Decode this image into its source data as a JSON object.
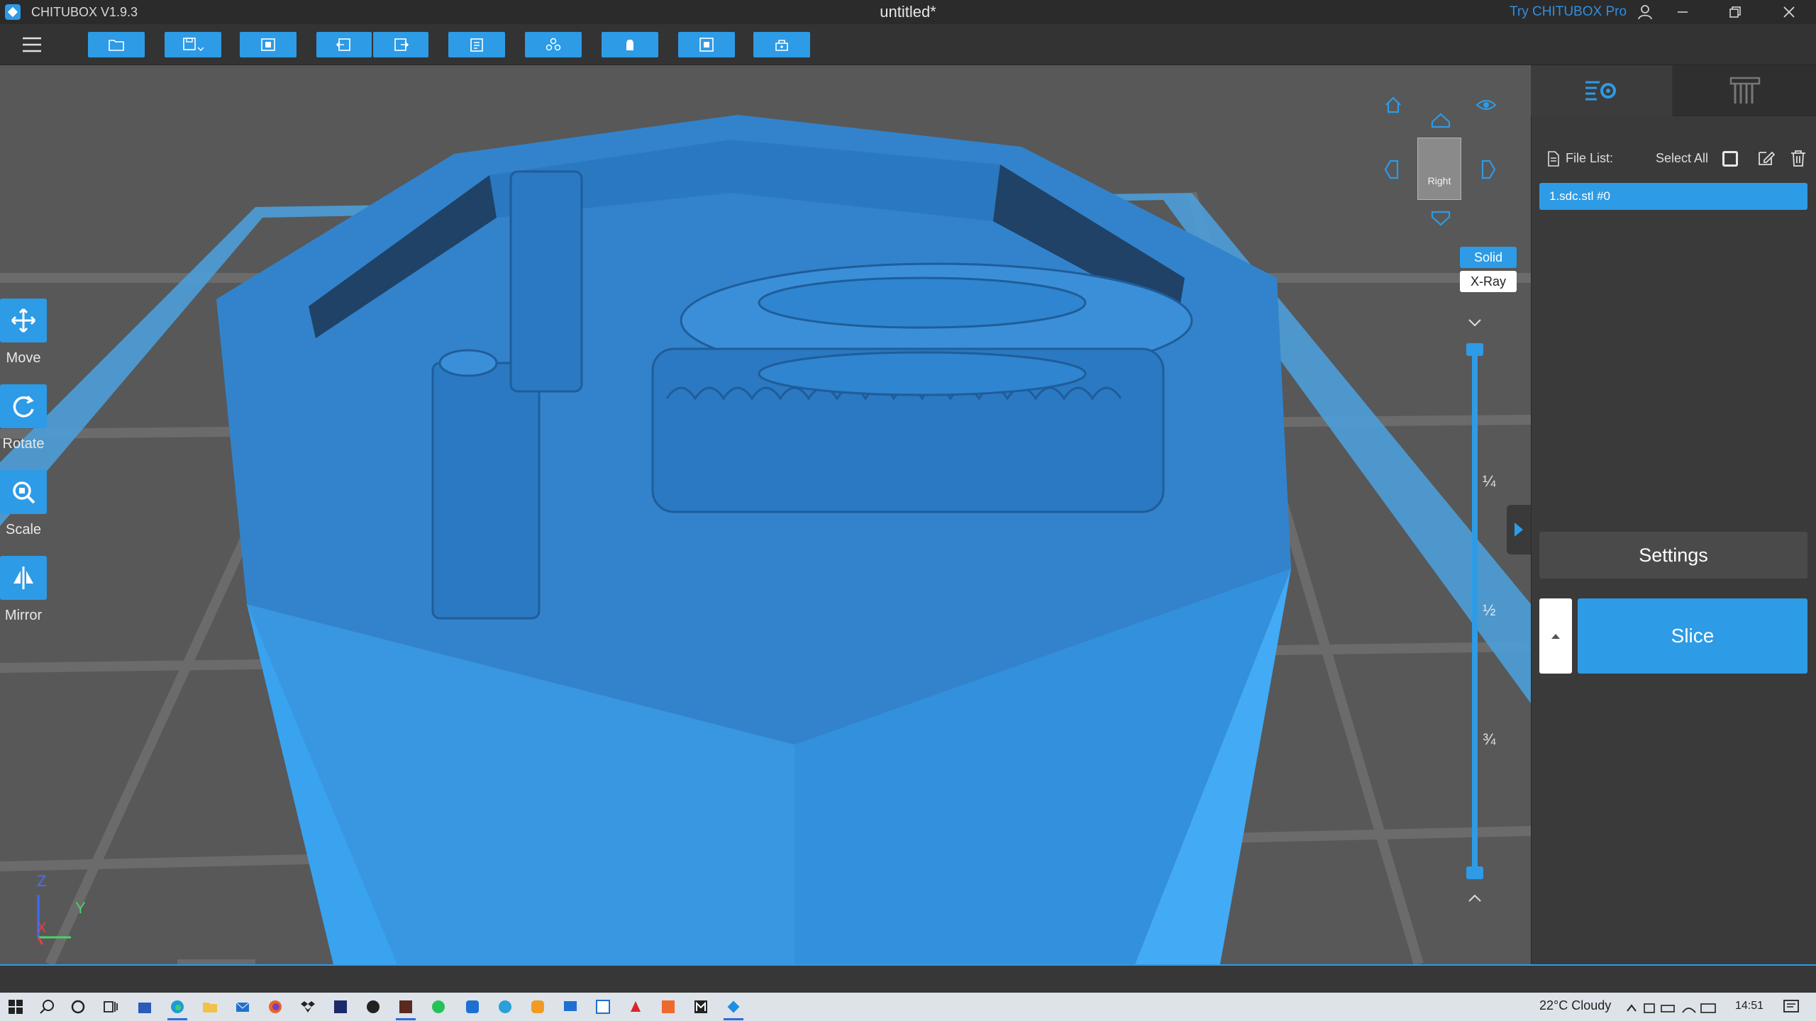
{
  "app": {
    "name": "CHITUBOX V1.9.3",
    "document_title": "untitled*",
    "try_pro": "Try CHITUBOX Pro"
  },
  "toolbar": {
    "buttons": [
      {
        "name": "open-file",
        "icon": "folder-icon"
      },
      {
        "name": "save",
        "icon": "save-icon"
      },
      {
        "name": "auto-layout",
        "icon": "layout-icon"
      },
      {
        "name": "undo",
        "icon": "undo-icon"
      },
      {
        "name": "redo",
        "icon": "redo-icon"
      },
      {
        "name": "copy",
        "icon": "copy-icon"
      },
      {
        "name": "arrange",
        "icon": "arrange-icon"
      },
      {
        "name": "hollow",
        "icon": "hollow-icon"
      },
      {
        "name": "dig-hole",
        "icon": "hole-icon"
      },
      {
        "name": "support",
        "icon": "support-icon"
      }
    ]
  },
  "tools": {
    "move": "Move",
    "rotate": "Rotate",
    "scale": "Scale",
    "mirror": "Mirror"
  },
  "view": {
    "cube_label": "Right",
    "solid": "Solid",
    "xray": "X-Ray",
    "active_mode": "Solid"
  },
  "layer_slider": {
    "marks": [
      "¼",
      "½",
      "¾"
    ]
  },
  "right_panel": {
    "file_list_label": "File List:",
    "select_all_label": "Select All",
    "files": [
      "1.sdc.stl #0"
    ],
    "settings_label": "Settings",
    "slice_label": "Slice"
  },
  "axes": {
    "z": "Z",
    "y": "Y",
    "x": "X"
  },
  "taskbar": {
    "weather": "22°C  Cloudy",
    "time": "14:51"
  },
  "colors": {
    "accent": "#2d9be6",
    "model": "#2f86cf",
    "viewport_bg": "#585858",
    "panel_bg": "#3a3a3a"
  }
}
